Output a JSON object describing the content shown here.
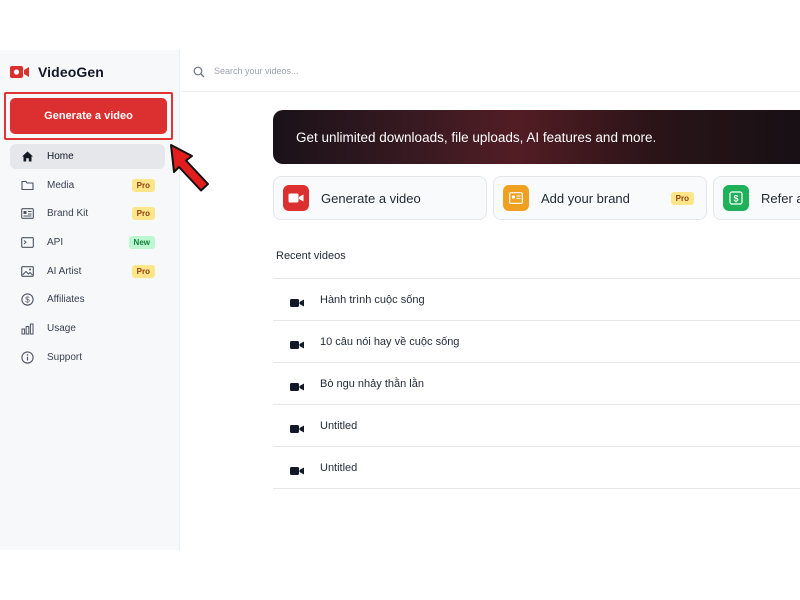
{
  "app": {
    "name": "VideoGen",
    "brand_color": "#dc2f2f"
  },
  "sidebar": {
    "generate_label": "Generate a video",
    "items": [
      {
        "label": "Home",
        "icon": "home-icon",
        "badge": ""
      },
      {
        "label": "Media",
        "icon": "folder-icon",
        "badge": "Pro"
      },
      {
        "label": "Brand Kit",
        "icon": "id-card-icon",
        "badge": "Pro"
      },
      {
        "label": "API",
        "icon": "terminal-icon",
        "badge": "New"
      },
      {
        "label": "AI Artist",
        "icon": "image-icon",
        "badge": "Pro"
      },
      {
        "label": "Affiliates",
        "icon": "dollar-icon",
        "badge": ""
      },
      {
        "label": "Usage",
        "icon": "bar-chart-icon",
        "badge": ""
      },
      {
        "label": "Support",
        "icon": "info-icon",
        "badge": ""
      }
    ]
  },
  "search": {
    "placeholder": "Search your videos..."
  },
  "banner": {
    "text": "Get unlimited downloads, file uploads, AI features and more."
  },
  "cards": [
    {
      "label": "Generate a video",
      "icon": "video-camera-icon",
      "color": "#dc2f2f",
      "badge": ""
    },
    {
      "label": "Add your brand",
      "icon": "id-card-icon",
      "color": "#f0a020",
      "badge": "Pro"
    },
    {
      "label": "Refer a",
      "icon": "dollar-icon",
      "color": "#1fb15a",
      "badge": ""
    }
  ],
  "recent": {
    "title": "Recent videos",
    "videos": [
      {
        "title": "Hành trình cuộc sống"
      },
      {
        "title": "10 câu nói hay về cuộc sống"
      },
      {
        "title": "Bò ngu nhảy thằn lằn"
      },
      {
        "title": "Untitled"
      },
      {
        "title": "Untitled"
      }
    ]
  }
}
